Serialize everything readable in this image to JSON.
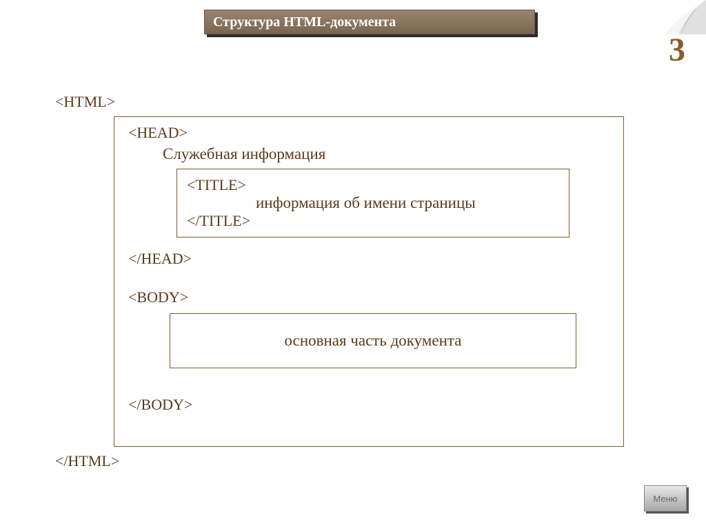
{
  "header": {
    "title": "Структура HTML-документа"
  },
  "page_number": "3",
  "structure": {
    "html_open": "<HTML>",
    "html_close": "</HTML>",
    "head_open": "<HEAD>",
    "head_descr": "Служебная информация",
    "head_close": "</HEAD>",
    "title_open": "<TITLE>",
    "title_content": "информация об имени страницы",
    "title_close": "</TITLE>",
    "body_open": "<BODY>",
    "body_content": "основная часть документа",
    "body_close": "</BODY>"
  },
  "menu": {
    "label": "Меню"
  }
}
